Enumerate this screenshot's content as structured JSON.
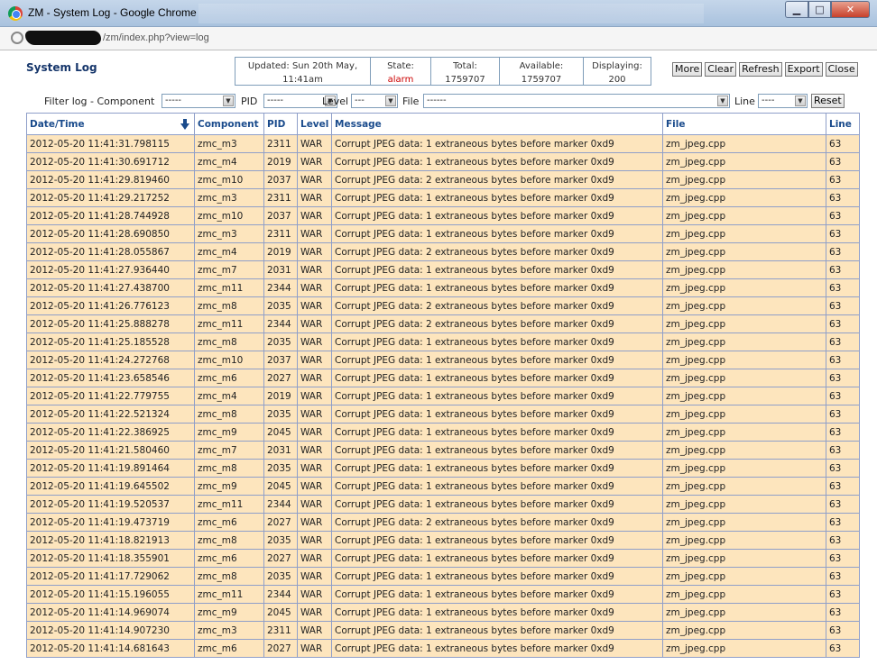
{
  "window": {
    "title": "ZM - System Log - Google Chrome",
    "url": "/zm/index.php?view=log",
    "buttons": {
      "minimize": "▁",
      "maximize": "□",
      "close": "✕"
    }
  },
  "header": {
    "title": "System Log",
    "updated_label": "Updated: Sun 20th May,",
    "updated_time": "11:41am",
    "state_label": "State:",
    "state_value": "alarm",
    "total_label": "Total:",
    "total_value": "1759707",
    "available_label": "Available:",
    "available_value": "1759707",
    "displaying_label": "Displaying:",
    "displaying_value": "200"
  },
  "actions": {
    "more": "More",
    "clear": "Clear",
    "refresh": "Refresh",
    "export": "Export",
    "close": "Close"
  },
  "filters": {
    "filter_log_label": "Filter log - Component",
    "component_value": "-----",
    "pid_label": "PID",
    "pid_value": "-----",
    "level_label": "Level",
    "level_value": "---",
    "file_label": "File",
    "file_value": "------",
    "line_label": "Line",
    "line_value": "----",
    "reset": "Reset"
  },
  "table": {
    "columns": [
      "Date/Time",
      "Component",
      "PID",
      "Level",
      "Message",
      "File",
      "Line"
    ],
    "rows": [
      [
        "2012-05-20 11:41:31.798115",
        "zmc_m3",
        "2311",
        "WAR",
        "Corrupt JPEG data: 1 extraneous bytes before marker 0xd9",
        "zm_jpeg.cpp",
        "63"
      ],
      [
        "2012-05-20 11:41:30.691712",
        "zmc_m4",
        "2019",
        "WAR",
        "Corrupt JPEG data: 1 extraneous bytes before marker 0xd9",
        "zm_jpeg.cpp",
        "63"
      ],
      [
        "2012-05-20 11:41:29.819460",
        "zmc_m10",
        "2037",
        "WAR",
        "Corrupt JPEG data: 2 extraneous bytes before marker 0xd9",
        "zm_jpeg.cpp",
        "63"
      ],
      [
        "2012-05-20 11:41:29.217252",
        "zmc_m3",
        "2311",
        "WAR",
        "Corrupt JPEG data: 1 extraneous bytes before marker 0xd9",
        "zm_jpeg.cpp",
        "63"
      ],
      [
        "2012-05-20 11:41:28.744928",
        "zmc_m10",
        "2037",
        "WAR",
        "Corrupt JPEG data: 1 extraneous bytes before marker 0xd9",
        "zm_jpeg.cpp",
        "63"
      ],
      [
        "2012-05-20 11:41:28.690850",
        "zmc_m3",
        "2311",
        "WAR",
        "Corrupt JPEG data: 1 extraneous bytes before marker 0xd9",
        "zm_jpeg.cpp",
        "63"
      ],
      [
        "2012-05-20 11:41:28.055867",
        "zmc_m4",
        "2019",
        "WAR",
        "Corrupt JPEG data: 2 extraneous bytes before marker 0xd9",
        "zm_jpeg.cpp",
        "63"
      ],
      [
        "2012-05-20 11:41:27.936440",
        "zmc_m7",
        "2031",
        "WAR",
        "Corrupt JPEG data: 1 extraneous bytes before marker 0xd9",
        "zm_jpeg.cpp",
        "63"
      ],
      [
        "2012-05-20 11:41:27.438700",
        "zmc_m11",
        "2344",
        "WAR",
        "Corrupt JPEG data: 1 extraneous bytes before marker 0xd9",
        "zm_jpeg.cpp",
        "63"
      ],
      [
        "2012-05-20 11:41:26.776123",
        "zmc_m8",
        "2035",
        "WAR",
        "Corrupt JPEG data: 2 extraneous bytes before marker 0xd9",
        "zm_jpeg.cpp",
        "63"
      ],
      [
        "2012-05-20 11:41:25.888278",
        "zmc_m11",
        "2344",
        "WAR",
        "Corrupt JPEG data: 2 extraneous bytes before marker 0xd9",
        "zm_jpeg.cpp",
        "63"
      ],
      [
        "2012-05-20 11:41:25.185528",
        "zmc_m8",
        "2035",
        "WAR",
        "Corrupt JPEG data: 1 extraneous bytes before marker 0xd9",
        "zm_jpeg.cpp",
        "63"
      ],
      [
        "2012-05-20 11:41:24.272768",
        "zmc_m10",
        "2037",
        "WAR",
        "Corrupt JPEG data: 1 extraneous bytes before marker 0xd9",
        "zm_jpeg.cpp",
        "63"
      ],
      [
        "2012-05-20 11:41:23.658546",
        "zmc_m6",
        "2027",
        "WAR",
        "Corrupt JPEG data: 1 extraneous bytes before marker 0xd9",
        "zm_jpeg.cpp",
        "63"
      ],
      [
        "2012-05-20 11:41:22.779755",
        "zmc_m4",
        "2019",
        "WAR",
        "Corrupt JPEG data: 1 extraneous bytes before marker 0xd9",
        "zm_jpeg.cpp",
        "63"
      ],
      [
        "2012-05-20 11:41:22.521324",
        "zmc_m8",
        "2035",
        "WAR",
        "Corrupt JPEG data: 1 extraneous bytes before marker 0xd9",
        "zm_jpeg.cpp",
        "63"
      ],
      [
        "2012-05-20 11:41:22.386925",
        "zmc_m9",
        "2045",
        "WAR",
        "Corrupt JPEG data: 1 extraneous bytes before marker 0xd9",
        "zm_jpeg.cpp",
        "63"
      ],
      [
        "2012-05-20 11:41:21.580460",
        "zmc_m7",
        "2031",
        "WAR",
        "Corrupt JPEG data: 1 extraneous bytes before marker 0xd9",
        "zm_jpeg.cpp",
        "63"
      ],
      [
        "2012-05-20 11:41:19.891464",
        "zmc_m8",
        "2035",
        "WAR",
        "Corrupt JPEG data: 1 extraneous bytes before marker 0xd9",
        "zm_jpeg.cpp",
        "63"
      ],
      [
        "2012-05-20 11:41:19.645502",
        "zmc_m9",
        "2045",
        "WAR",
        "Corrupt JPEG data: 1 extraneous bytes before marker 0xd9",
        "zm_jpeg.cpp",
        "63"
      ],
      [
        "2012-05-20 11:41:19.520537",
        "zmc_m11",
        "2344",
        "WAR",
        "Corrupt JPEG data: 1 extraneous bytes before marker 0xd9",
        "zm_jpeg.cpp",
        "63"
      ],
      [
        "2012-05-20 11:41:19.473719",
        "zmc_m6",
        "2027",
        "WAR",
        "Corrupt JPEG data: 2 extraneous bytes before marker 0xd9",
        "zm_jpeg.cpp",
        "63"
      ],
      [
        "2012-05-20 11:41:18.821913",
        "zmc_m8",
        "2035",
        "WAR",
        "Corrupt JPEG data: 1 extraneous bytes before marker 0xd9",
        "zm_jpeg.cpp",
        "63"
      ],
      [
        "2012-05-20 11:41:18.355901",
        "zmc_m6",
        "2027",
        "WAR",
        "Corrupt JPEG data: 1 extraneous bytes before marker 0xd9",
        "zm_jpeg.cpp",
        "63"
      ],
      [
        "2012-05-20 11:41:17.729062",
        "zmc_m8",
        "2035",
        "WAR",
        "Corrupt JPEG data: 1 extraneous bytes before marker 0xd9",
        "zm_jpeg.cpp",
        "63"
      ],
      [
        "2012-05-20 11:41:15.196055",
        "zmc_m11",
        "2344",
        "WAR",
        "Corrupt JPEG data: 1 extraneous bytes before marker 0xd9",
        "zm_jpeg.cpp",
        "63"
      ],
      [
        "2012-05-20 11:41:14.969074",
        "zmc_m9",
        "2045",
        "WAR",
        "Corrupt JPEG data: 1 extraneous bytes before marker 0xd9",
        "zm_jpeg.cpp",
        "63"
      ],
      [
        "2012-05-20 11:41:14.907230",
        "zmc_m3",
        "2311",
        "WAR",
        "Corrupt JPEG data: 1 extraneous bytes before marker 0xd9",
        "zm_jpeg.cpp",
        "63"
      ],
      [
        "2012-05-20 11:41:14.681643",
        "zmc_m6",
        "2027",
        "WAR",
        "Corrupt JPEG data: 1 extraneous bytes before marker 0xd9",
        "zm_jpeg.cpp",
        "63"
      ]
    ]
  },
  "colors": {
    "row_bg": "#fde5bd",
    "header_text": "#1a4b8c",
    "grid": "#8f9fc9",
    "state_alarm": "#cc0000"
  }
}
